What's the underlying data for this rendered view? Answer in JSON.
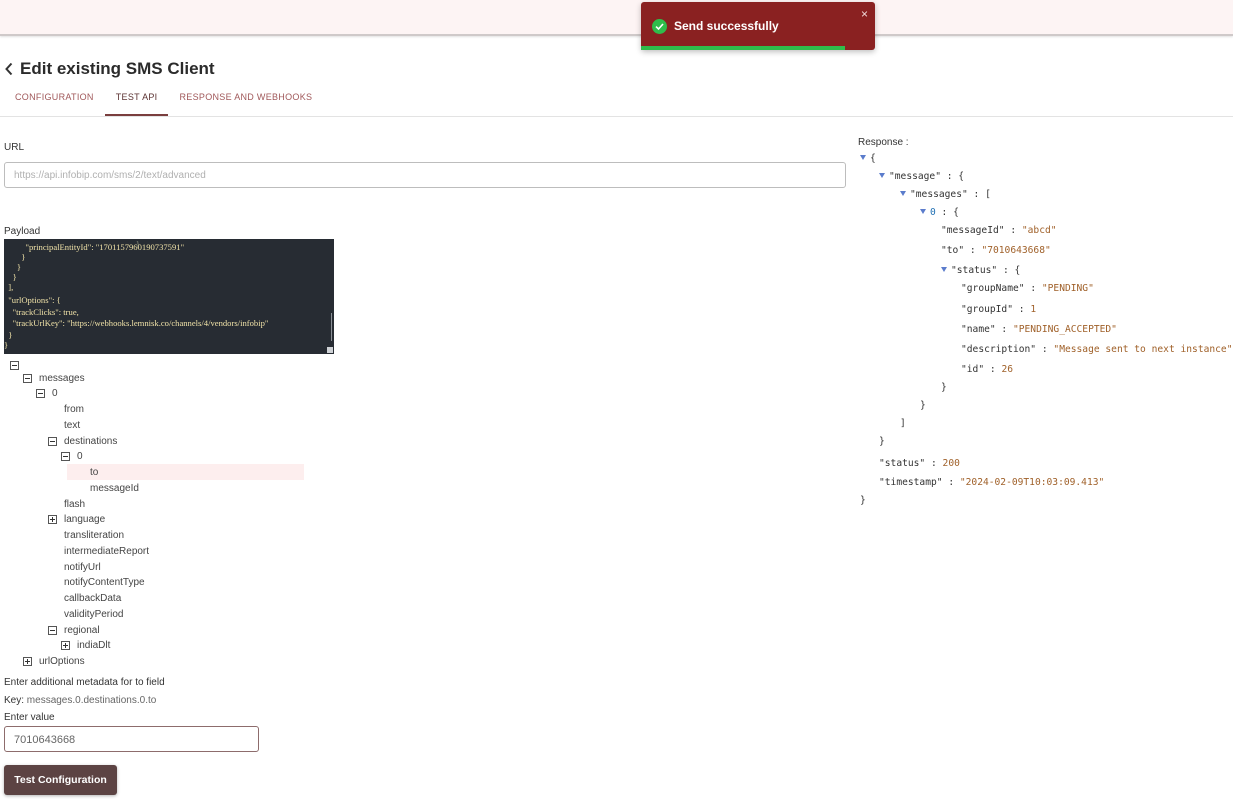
{
  "toast": {
    "message": "Send successfully",
    "close": "×",
    "progress_fraction": 0.87,
    "color": "#8a2121",
    "progress_color": "#2fbd4b"
  },
  "page": {
    "title": "Edit existing SMS Client",
    "back_icon": "chevron-left-icon"
  },
  "tabs": [
    {
      "label": "CONFIGURATION",
      "active": false
    },
    {
      "label": "TEST API",
      "active": true
    },
    {
      "label": "RESPONSE AND WEBHOOKS",
      "active": false
    }
  ],
  "url": {
    "label": "URL",
    "placeholder": "https://api.infobip.com/sms/2/text/advanced"
  },
  "payload": {
    "label": "Payload",
    "code_lines": [
      "          \"principalEntityId\": \"1701157960190737591\"",
      "        }",
      "      }",
      "    }",
      "  ],",
      "  \"urlOptions\": {",
      "    \"trackClicks\": true,",
      "    \"trackUrlKey\": \"https://webhooks.lemnisk.co/channels/4/vendors/infobip\"",
      "  }",
      "}"
    ]
  },
  "tree": [
    {
      "label": "",
      "toggle": "minus"
    },
    {
      "label": "messages",
      "toggle": "minus"
    },
    {
      "label": "0",
      "toggle": "minus"
    },
    {
      "label": "from",
      "toggle": null
    },
    {
      "label": "text",
      "toggle": null
    },
    {
      "label": "destinations",
      "toggle": "minus"
    },
    {
      "label": "0",
      "toggle": "minus"
    },
    {
      "label": "to",
      "toggle": null,
      "selected": true
    },
    {
      "label": "messageId",
      "toggle": null
    },
    {
      "label": "flash",
      "toggle": null
    },
    {
      "label": "language",
      "toggle": "plus"
    },
    {
      "label": "transliteration",
      "toggle": null
    },
    {
      "label": "intermediateReport",
      "toggle": null
    },
    {
      "label": "notifyUrl",
      "toggle": null
    },
    {
      "label": "notifyContentType",
      "toggle": null
    },
    {
      "label": "callbackData",
      "toggle": null
    },
    {
      "label": "validityPeriod",
      "toggle": null
    },
    {
      "label": "regional",
      "toggle": "minus"
    },
    {
      "label": "indiaDlt",
      "toggle": "plus"
    },
    {
      "label": "urlOptions",
      "toggle": "plus"
    }
  ],
  "metadata": {
    "prompt": "Enter additional metadata for to field",
    "key_label": "Key:",
    "key_value": "messages.0.destinations.0.to",
    "value_label": "Enter value",
    "value": "7010643668"
  },
  "actions": {
    "test_label": "Test Configuration"
  },
  "response": {
    "label": "Response :",
    "rows": [
      {
        "t": "{"
      },
      {
        "k": "\"message\"",
        "t": " : {"
      },
      {
        "k": "\"messages\"",
        "t": " : ["
      },
      {
        "i": "0",
        "t": " : {"
      },
      {
        "k": "\"messageId\"",
        "t": " : ",
        "s": "\"abcd\""
      },
      {
        "k": "\"to\"",
        "t": " : ",
        "s": "\"7010643668\""
      },
      {
        "k": "\"status\"",
        "t": " : {"
      },
      {
        "k": "\"groupName\"",
        "t": " : ",
        "s": "\"PENDING\""
      },
      {
        "k": "\"groupId\"",
        "t": " : ",
        "s": "1"
      },
      {
        "k": "\"name\"",
        "t": " : ",
        "s": "\"PENDING_ACCEPTED\""
      },
      {
        "k": "\"description\"",
        "t": " : ",
        "s": "\"Message sent to next instance\""
      },
      {
        "k": "\"id\"",
        "t": " : ",
        "s": "26"
      },
      {
        "t": "}"
      },
      {
        "t": "}"
      },
      {
        "t": "]"
      },
      {
        "t": "}"
      },
      {
        "k": "\"status\"",
        "t": " : ",
        "s": "200"
      },
      {
        "k": "\"timestamp\"",
        "t": " : ",
        "s": "\"2024-02-09T10:03:09.413\""
      },
      {
        "t": "}"
      }
    ]
  }
}
